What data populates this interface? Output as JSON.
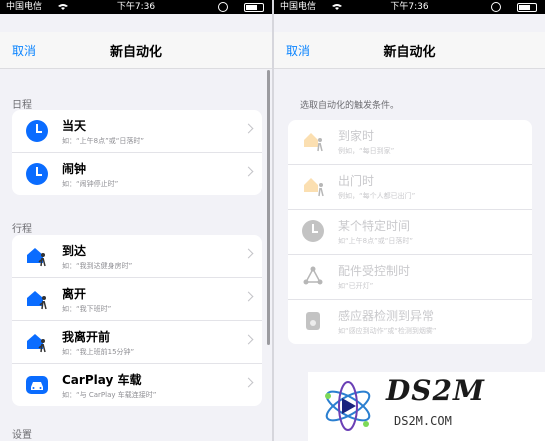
{
  "status": {
    "carrier": "中国电信",
    "time": "下午7:36"
  },
  "left": {
    "cancel": "取消",
    "title": "新自动化",
    "sections": [
      {
        "label": "日程",
        "items": [
          {
            "title": "当天",
            "example": "如：“上午8点”或“日落时”",
            "icon": "clock-icon"
          },
          {
            "title": "闹钟",
            "example": "如：“闹钟停止时”",
            "icon": "clock-icon"
          }
        ]
      },
      {
        "label": "行程",
        "items": [
          {
            "title": "到达",
            "example": "如：“我到达健身房时”",
            "icon": "arrive-icon"
          },
          {
            "title": "离开",
            "example": "如：“我下班时”",
            "icon": "leave-icon"
          },
          {
            "title": "我离开前",
            "example": "如：“我上班前15分钟”",
            "icon": "before-leave-icon"
          },
          {
            "title": "CarPlay 车载",
            "example": "如：“与 CarPlay 车载连接时”",
            "icon": "car-icon"
          }
        ]
      },
      {
        "label": "设置"
      }
    ]
  },
  "right": {
    "cancel": "取消",
    "title": "新自动化",
    "instruction": "选取自动化的触发条件。",
    "items": [
      {
        "title": "到家时",
        "example": "例如，“每日到家”",
        "icon": "home-arrive-icon"
      },
      {
        "title": "出门时",
        "example": "例如，“每个人都已出门”",
        "icon": "home-leave-icon"
      },
      {
        "title": "某个特定时间",
        "example": "如“上午8点”或“日落时”",
        "icon": "clock-icon"
      },
      {
        "title": "配件受控制时",
        "example": "如“已开灯”",
        "icon": "accessory-icon"
      },
      {
        "title": "感应器检测到异常",
        "example": "如“感应到动作”或“检测到烟雾”",
        "icon": "sensor-icon"
      }
    ]
  },
  "watermark": {
    "logo_text": "DS2M",
    "url": "DS2M.COM"
  }
}
